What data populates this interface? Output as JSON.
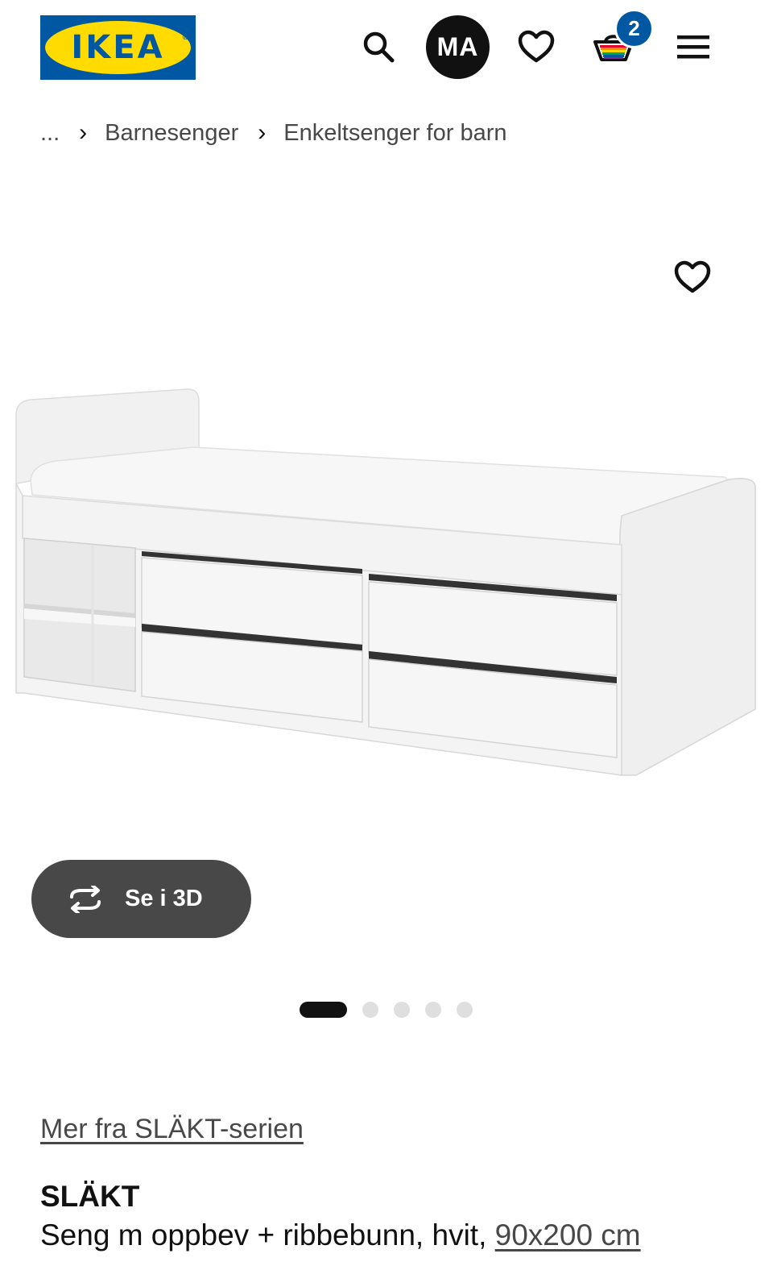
{
  "header": {
    "logo_text": "IKEA",
    "logo_registered": "®",
    "avatar_initials": "MA",
    "cart_count": "2",
    "icons": [
      "search-icon",
      "heart-icon",
      "cart-icon",
      "menu-icon"
    ],
    "colors": {
      "brand_blue": "#0058a3",
      "brand_yellow": "#ffdb00"
    }
  },
  "breadcrumb": {
    "items": [
      "...",
      "Barnesenger",
      "Enkeltsenger for barn"
    ],
    "separator": "›"
  },
  "gallery": {
    "button_3d_label": "Se i 3D",
    "slide_count": 5,
    "active_slide": 1
  },
  "product": {
    "series_link": "Mer fra SLÄKT-serien",
    "name": "SLÄKT",
    "description": "Seng m oppbev + ribbebunn, hvit, ",
    "size_link": "90x200 cm"
  }
}
